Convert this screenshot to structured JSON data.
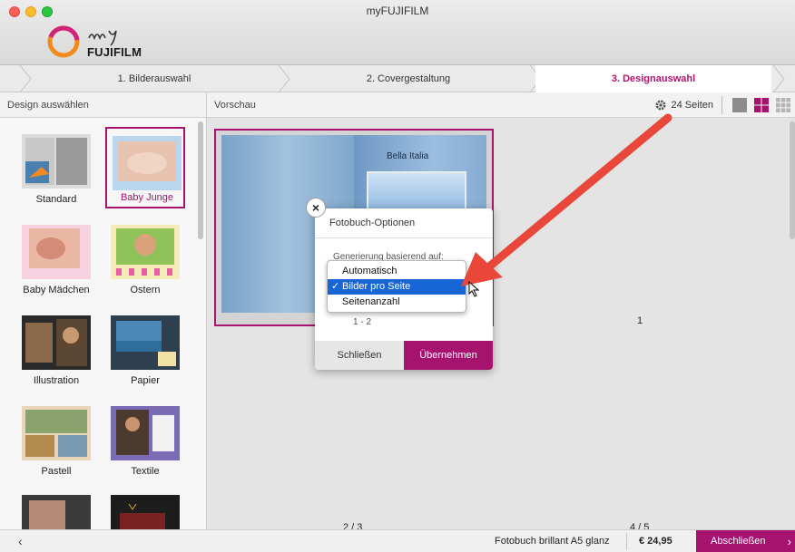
{
  "window": {
    "title": "myFUJIFILM"
  },
  "logo": {
    "brand": "FUJIFILM",
    "script": "my"
  },
  "steps": [
    {
      "label": "1. Bilderauswahl"
    },
    {
      "label": "2. Covergestaltung"
    },
    {
      "label": "3. Designauswahl"
    }
  ],
  "left_panel": {
    "header": "Design auswählen",
    "designs": [
      {
        "label": "Standard"
      },
      {
        "label": "Baby Junge"
      },
      {
        "label": "Baby Mädchen"
      },
      {
        "label": "Ostern"
      },
      {
        "label": "Illustration"
      },
      {
        "label": "Papier"
      },
      {
        "label": "Pastell"
      },
      {
        "label": "Textile"
      }
    ]
  },
  "preview": {
    "header": "Vorschau",
    "pages_label": "24 Seiten",
    "book_title": "Bella Italia",
    "page_number_right": "1",
    "bottom_page_left": "2 / 3",
    "bottom_page_right": "4 / 5"
  },
  "dialog": {
    "close_x": "×",
    "title": "Fotobuch-Optionen",
    "label": "Generierung basierend auf:",
    "range": "1 - 2",
    "close_button": "Schließen",
    "apply_button": "Übernehmen"
  },
  "dropdown": {
    "options": [
      "Automatisch",
      "Bilder pro Seite",
      "Seitenanzahl"
    ],
    "selected": "Bilder pro Seite",
    "check": "✓"
  },
  "footer": {
    "back": "‹",
    "product": "Fotobuch brillant A5 glanz",
    "price": "€ 24,95",
    "finish_button": "Abschließen",
    "finish_chevron": "›"
  },
  "colors": {
    "accent": "#a5136f",
    "menu_selection": "#1866d6",
    "annotation_arrow": "#e8473a"
  }
}
